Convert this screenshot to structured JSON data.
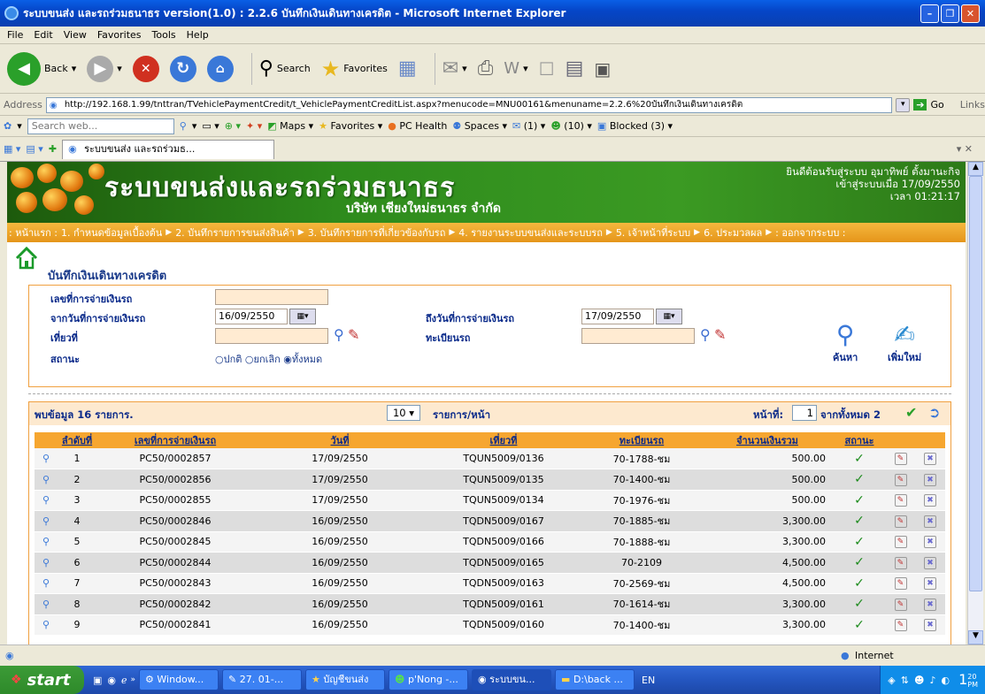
{
  "window": {
    "title": "ระบบขนส่ง และรถร่วมธนาธร version(1.0) : 2.2.6 บันทึกเงินเดินทางเครดิต - Microsoft Internet Explorer",
    "min": "–",
    "max": "❐",
    "close": "✕"
  },
  "menu": [
    "File",
    "Edit",
    "View",
    "Favorites",
    "Tools",
    "Help"
  ],
  "toolbar": {
    "back": "Back",
    "search": "Search",
    "favorites": "Favorites"
  },
  "address": {
    "label": "Address",
    "url": "http://192.168.1.99/tnttran/TVehiclePaymentCredit/t_VehiclePaymentCreditList.aspx?menucode=MNU00161&menuname=2.2.6%20บันทึกเงินเดินทางเครดิต",
    "go": "Go",
    "links": "Links"
  },
  "linksbar": {
    "search_placeholder": "Search web...",
    "maps": "Maps",
    "favorites": "Favorites",
    "pchealth": "PC Health",
    "spaces": "Spaces",
    "mail": "(1)",
    "messenger": "(10)",
    "blocked": "Blocked (3)"
  },
  "tab": {
    "label": "ระบบขนส่ง และรถร่วมธ..."
  },
  "banner": {
    "title": "ระบบขนส่งและรถร่วมธนาธร",
    "subtitle": "บริษัท เชียงใหม่ธนาธร จำกัด",
    "welcome": "ยินดีต้อนรับสู่ระบบ อุมาทิพย์ ตั้งมานะกิจ",
    "login": "เข้าสู่ระบบเมื่อ 17/09/2550",
    "time": "เวลา 01:21:17"
  },
  "nav": [
    ": หน้าแรก :",
    "1. กำหนดข้อมูลเบื้องต้น",
    "2. บันทึกรายการขนส่งสินค้า",
    "3. บันทึกรายการที่เกี่ยวข้องกับรถ",
    "4. รายงานระบบขนส่งและระบบรถ",
    "5. เจ้าหน้าที่ระบบ",
    "6. ประมวลผล",
    ": ออกจากระบบ :"
  ],
  "page_title": "บันทึกเงินเดินทางเครดิต",
  "filter": {
    "payment_no_label": "เลขที่การจ่ายเงินรถ",
    "from_date_label": "จากวันที่การจ่ายเงินรถ",
    "from_date": "16/09/2550",
    "to_date_label": "ถึงวันที่การจ่ายเงินรถ",
    "to_date": "17/09/2550",
    "trip_label": "เที่ยวที่",
    "plate_label": "ทะเบียนรถ",
    "status_label": "สถานะ",
    "radio_normal": "ปกติ",
    "radio_cancel": "ยกเลิก",
    "radio_all": "ทั้งหมด",
    "search_btn": "ค้นหา",
    "add_btn": "เพิ่มใหม่"
  },
  "results": {
    "found": "พบข้อมูล 16 รายการ.",
    "page_size": "10",
    "per_page": "รายการ/หน้า",
    "page_label": "หน้าที่:",
    "page_no": "1",
    "total_pages": "จากทั้งหมด 2"
  },
  "table": {
    "headers": [
      "ลำดับที่",
      "เลขที่การจ่ายเงินรถ",
      "วันที่",
      "เที่ยวที่",
      "ทะเบียนรถ",
      "จำนวนเงินรวม",
      "สถานะ"
    ],
    "rows": [
      [
        "1",
        "PC50/0002857",
        "17/09/2550",
        "TQUN5009/0136",
        "70-1788-ชม",
        "500.00"
      ],
      [
        "2",
        "PC50/0002856",
        "17/09/2550",
        "TQUN5009/0135",
        "70-1400-ชม",
        "500.00"
      ],
      [
        "3",
        "PC50/0002855",
        "17/09/2550",
        "TQUN5009/0134",
        "70-1976-ชม",
        "500.00"
      ],
      [
        "4",
        "PC50/0002846",
        "16/09/2550",
        "TQDN5009/0167",
        "70-1885-ชม",
        "3,300.00"
      ],
      [
        "5",
        "PC50/0002845",
        "16/09/2550",
        "TQDN5009/0166",
        "70-1888-ชม",
        "3,300.00"
      ],
      [
        "6",
        "PC50/0002844",
        "16/09/2550",
        "TQDN5009/0165",
        "70-2109",
        "4,500.00"
      ],
      [
        "7",
        "PC50/0002843",
        "16/09/2550",
        "TQDN5009/0163",
        "70-2569-ชม",
        "4,500.00"
      ],
      [
        "8",
        "PC50/0002842",
        "16/09/2550",
        "TQDN5009/0161",
        "70-1614-ชม",
        "3,300.00"
      ],
      [
        "9",
        "PC50/0002841",
        "16/09/2550",
        "TQDN5009/0160",
        "70-1400-ชม",
        "3,300.00"
      ]
    ]
  },
  "status": {
    "zone": "Internet"
  },
  "taskbar": {
    "start": "start",
    "items": [
      "Window...",
      "27. 01-...",
      "บัญชีขนส่ง",
      "p'Nong -...",
      "ระบบขน...",
      "D:\\back ..."
    ],
    "lang": "EN",
    "clock_hour": "1",
    "clock_min": "20",
    "clock_ampm": "PM"
  },
  "colors": {
    "banner": "#2e8b1c",
    "nav": "#f0a52a",
    "table_header": "#F6A630",
    "input_bg": "#FFEBD2"
  }
}
